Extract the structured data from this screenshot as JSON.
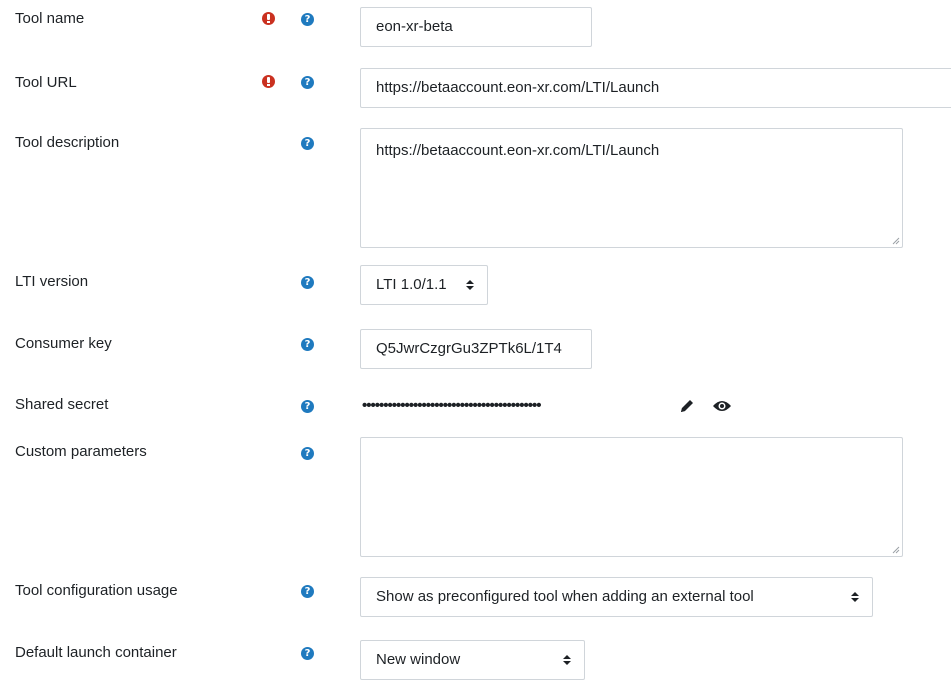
{
  "fields": {
    "tool_name": {
      "label": "Tool name",
      "value": "eon-xr-beta"
    },
    "tool_url": {
      "label": "Tool URL",
      "value": "https://betaaccount.eon-xr.com/LTI/Launch"
    },
    "tool_description": {
      "label": "Tool description",
      "value": "https://betaaccount.eon-xr.com/LTI/Launch"
    },
    "lti_version": {
      "label": "LTI version",
      "value": "LTI 1.0/1.1"
    },
    "consumer_key": {
      "label": "Consumer key",
      "value": "Q5JwrCzgrGu3ZPTk6L/1T4"
    },
    "shared_secret": {
      "label": "Shared secret",
      "value": "••••••••••••••••••••••••••••••••••••••••••"
    },
    "custom_parameters": {
      "label": "Custom parameters",
      "value": ""
    },
    "tool_configuration_usage": {
      "label": "Tool configuration usage",
      "value": "Show as preconfigured tool when adding an external tool"
    },
    "default_launch_container": {
      "label": "Default launch container",
      "value": "New window"
    }
  },
  "icons": {
    "required": "exclamation-circle-icon",
    "help": "question-circle-icon",
    "edit": "pencil-icon",
    "reveal": "eye-icon"
  },
  "help_glyph": "?"
}
